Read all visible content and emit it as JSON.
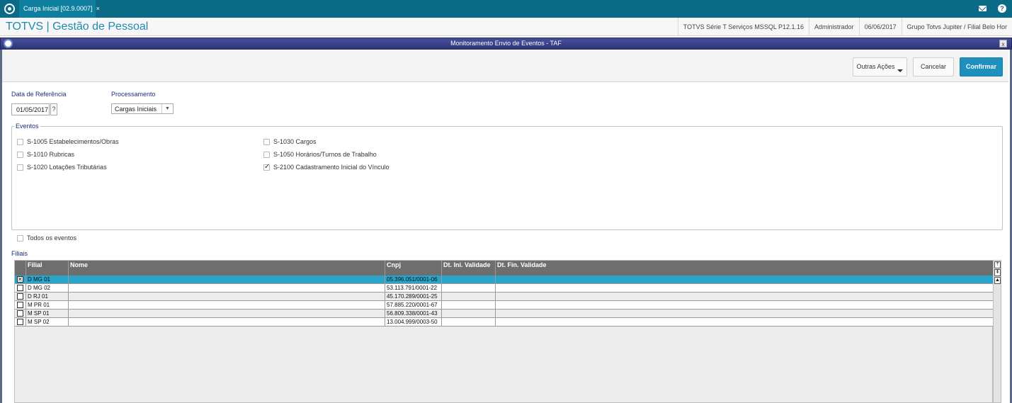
{
  "topbar": {
    "tab_label": "Carga Inicial [02.9.0007]",
    "tab_close": "×"
  },
  "header": {
    "app_title": "TOTVS | Gestão de Pessoal",
    "system": "TOTVS Série T Serviços MSSQL P12.1.16",
    "user": "Administrador",
    "date": "06/06/2017",
    "company": "Grupo Totvs Jupiter / Filial Belo Hor"
  },
  "dialog": {
    "title": "Monitoramento Envio de Eventos - TAF",
    "close": "x"
  },
  "toolbar": {
    "outras_acoes": "Outras Ações",
    "cancelar": "Cancelar",
    "confirmar": "Confirmar"
  },
  "form": {
    "data_referencia_label": "Data de Referência",
    "data_referencia_value": "01/05/2017",
    "data_help": "?",
    "processamento_label": "Processamento",
    "processamento_value": "Cargas Iniciais",
    "dropdown_arrow": "▼"
  },
  "eventos": {
    "title": "Eventos",
    "items": [
      {
        "label": "S-1005 Estabelecimentos/Obras",
        "checked": false
      },
      {
        "label": "S-1010 Rubricas",
        "checked": false
      },
      {
        "label": "S-1020 Lotações Tributárias",
        "checked": false
      },
      {
        "label": "S-1030 Cargos",
        "checked": false
      },
      {
        "label": "S-1050 Horários/Turnos de Trabalho",
        "checked": false
      },
      {
        "label": "S-2100 Cadastramento Inicial do Vínculo",
        "checked": true
      }
    ],
    "todos_label": "Todos os eventos"
  },
  "filiais": {
    "title": "Filiais",
    "columns": [
      "Filial",
      "Nome",
      "Cnpj",
      "Dt. Ini. Validade",
      "Dt. Fin. Validade"
    ],
    "rows": [
      {
        "filial": "D MG 01",
        "nome": "",
        "cnpj": "05.396.051/0001-06",
        "checked": true
      },
      {
        "filial": "D MG 02",
        "nome": "",
        "cnpj": "53.113.791/0001-22",
        "checked": false
      },
      {
        "filial": "D RJ 01",
        "nome": "",
        "cnpj": "45.170.289/0001-25",
        "checked": false
      },
      {
        "filial": "M PR 01",
        "nome": "",
        "cnpj": "57.885.220/0001-67",
        "checked": false
      },
      {
        "filial": "M SP 01",
        "nome": "",
        "cnpj": "56.809.338/0001-43",
        "checked": false
      },
      {
        "filial": "M SP 02",
        "nome": "",
        "cnpj": "13.004.999/0003-50",
        "checked": false
      }
    ]
  },
  "scrollbar": {
    "top": "⤒",
    "page_up": "⇞",
    "up": "▲"
  },
  "colors": {
    "brand": "#1f8bb0",
    "topbar": "#0b6a86",
    "dialog_bar": "#2d3478",
    "confirm": "#1f8fbd",
    "selected_row": "#2aa4c8"
  }
}
